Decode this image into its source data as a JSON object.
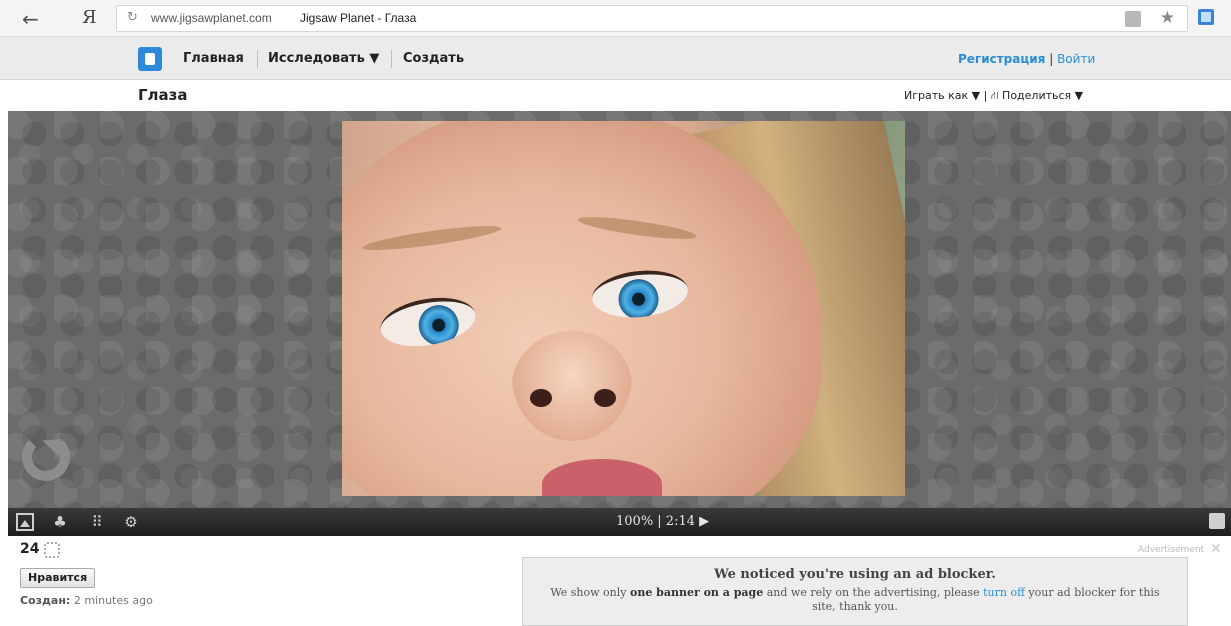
{
  "browser": {
    "back_glyph": "←",
    "yandex_glyph": "Я",
    "reload_glyph": "↻",
    "domain": "www.jigsawplanet.com",
    "page_title": "Jigsaw Planet - Глаза",
    "star_glyph": "★"
  },
  "nav": {
    "items": [
      "Главная",
      "Исследовать ▼",
      "Создать"
    ],
    "register": "Регистрация",
    "separator": "|",
    "login": "Войти"
  },
  "puzzle": {
    "title": "Глаза",
    "play_as": "Играть как ▼ |",
    "share_glyph": "⛙",
    "share": "Поделиться ▼",
    "status": "100% | 2:14 ▶"
  },
  "toolbar_glyphs": {
    "ghost": "♣",
    "grid": "⠿",
    "gear": "⚙"
  },
  "info": {
    "piece_count": "24",
    "like_label": "Нравится",
    "created_label": "Создан:",
    "created_value": "2 minutes ago"
  },
  "ad": {
    "label": "Advertisement",
    "close": "✕",
    "heading": "We noticed you're using an ad blocker.",
    "text_1": "We show only ",
    "text_bold": "one banner on a page",
    "text_2": " and we rely on the advertising, please ",
    "text_link": "turn off",
    "text_3": " your ad blocker for this site, thank you."
  },
  "colors": {
    "accent": "#2a8ed6",
    "toolbar_bg": "#1e1e1e",
    "puzzle_bg": "#6b6b6b"
  }
}
